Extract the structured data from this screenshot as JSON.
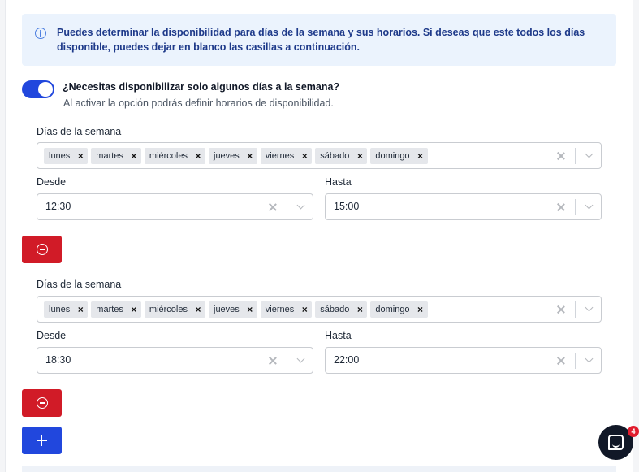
{
  "info": {
    "text": "Puedes determinar la disponibilidad para días de la semana y sus horarios. Si deseas que este todos los días disponible, puedes dejar en blanco las casillas a continuación."
  },
  "toggle": {
    "checked": true,
    "title": "¿Necesitas disponibilizar solo algunos días a la semana?",
    "subtitle": "Al activar la opción podrás definir horarios de disponibilidad."
  },
  "schedules": [
    {
      "days_label": "Días de la semana",
      "days": [
        "lunes",
        "martes",
        "miércoles",
        "jueves",
        "viernes",
        "sábado",
        "domingo"
      ],
      "from_label": "Desde",
      "from_value": "12:30",
      "to_label": "Hasta",
      "to_value": "15:00"
    },
    {
      "days_label": "Días de la semana",
      "days": [
        "lunes",
        "martes",
        "miércoles",
        "jueves",
        "viernes",
        "sábado",
        "domingo"
      ],
      "from_label": "Desde",
      "from_value": "18:30",
      "to_label": "Hasta",
      "to_value": "22:00"
    }
  ],
  "chat": {
    "badge_count": "4"
  },
  "colors": {
    "primary": "#2147dd",
    "danger": "#d11b27",
    "info_bg": "#ebf3fd",
    "info_text": "#1e3a8a"
  },
  "icons": {
    "info": "info-icon",
    "remove": "minus-circle-icon",
    "add": "plus-icon",
    "chip_remove": "close-icon",
    "clear": "clear-icon",
    "dropdown": "chevron-down-icon",
    "chat": "chat-icon"
  }
}
